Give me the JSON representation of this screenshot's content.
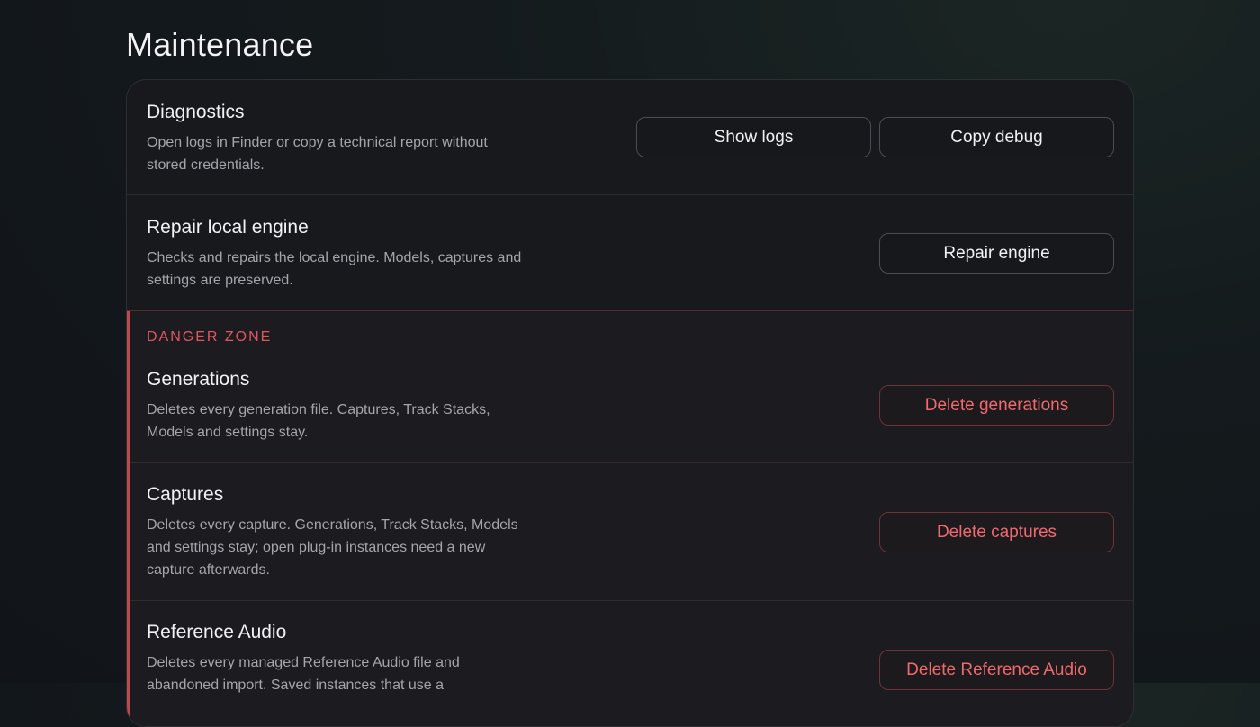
{
  "page": {
    "title": "Maintenance"
  },
  "diagnostics": {
    "title": "Diagnostics",
    "description": "Open logs in Finder or copy a technical report without stored credentials.",
    "show_logs_label": "Show logs",
    "copy_debug_label": "Copy debug"
  },
  "repair": {
    "title": "Repair local engine",
    "description": "Checks and repairs the local engine. Models, captures and settings are preserved.",
    "button_label": "Repair engine"
  },
  "danger_zone": {
    "label": "DANGER ZONE",
    "items": [
      {
        "title": "Generations",
        "description": "Deletes every generation file. Captures, Track Stacks, Models and settings stay.",
        "button_label": "Delete generations"
      },
      {
        "title": "Captures",
        "description": "Deletes every capture. Generations, Track Stacks, Models and settings stay; open plug-in instances need a new capture afterwards.",
        "button_label": "Delete captures"
      },
      {
        "title": "Reference Audio",
        "description": "Deletes every managed Reference Audio file and abandoned import. Saved instances that use a",
        "button_label": "Delete Reference Audio"
      }
    ]
  },
  "colors": {
    "accent_danger": "#e0585e",
    "danger_border": "#6b3438"
  }
}
